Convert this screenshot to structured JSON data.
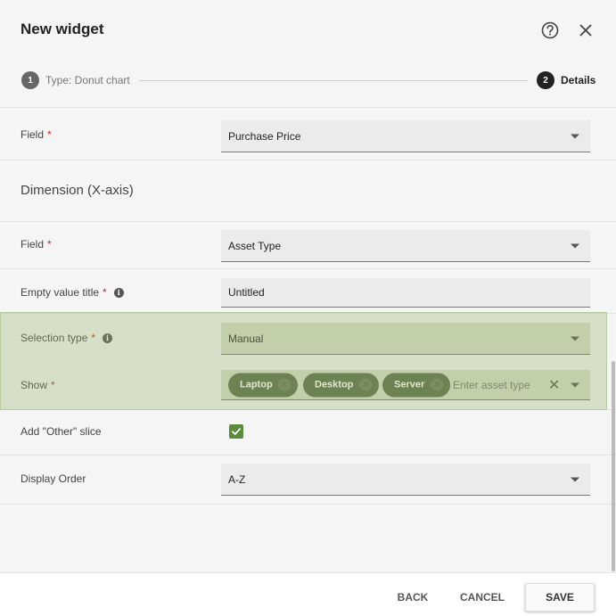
{
  "dialog": {
    "title": "New widget"
  },
  "stepper": {
    "step1": {
      "number": "1",
      "label": "Type: Donut chart"
    },
    "step2": {
      "number": "2",
      "label": "Details"
    }
  },
  "measure_field": {
    "label": "Field",
    "required": "*",
    "value": "Purchase Price"
  },
  "dimension": {
    "section_title": "Dimension (X-axis)"
  },
  "dimension_field": {
    "label": "Field",
    "required": "*",
    "value": "Asset Type"
  },
  "empty_value_title": {
    "label": "Empty value title",
    "required": "*",
    "info": "i",
    "value": "Untitled"
  },
  "selection_type": {
    "label": "Selection type",
    "required": "*",
    "info": "i",
    "value": "Manual"
  },
  "show": {
    "label": "Show",
    "required": "*",
    "chips": [
      "Laptop",
      "Desktop",
      "Server"
    ],
    "placeholder": "Enter asset type",
    "clear": "✕"
  },
  "other_slice": {
    "label": "Add \"Other\" slice",
    "checked": true
  },
  "display_order": {
    "label": "Display Order",
    "value": "A-Z"
  },
  "footer": {
    "back": "BACK",
    "cancel": "CANCEL",
    "save": "SAVE"
  },
  "colors": {
    "chip": "#5b6a48",
    "checkbox": "#5b8a3a",
    "required": "#c62828",
    "highlight": "#94b46e"
  }
}
